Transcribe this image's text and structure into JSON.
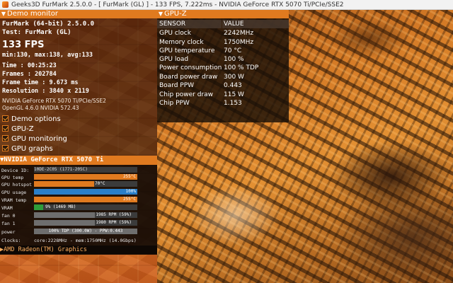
{
  "window": {
    "title": "Geeks3D FurMark 2.5.0.0 - [ FurMark (GL) ] - 133 FPS, 7.222ms - NVIDIA GeForce RTX 5070 Ti/PCIe/SSE2"
  },
  "demo_monitor": {
    "header": "Demo monitor",
    "app_line": "FurMark (64-bit) 2.5.0.0",
    "test_line": "Test: FurMark (GL)",
    "fps": "133 FPS",
    "minmax": "min:130, max:138, avg:133",
    "time": "Time        : 00:25:23",
    "frames": "Frames      : 202784",
    "frame_time": "Frame time : 9.673 ms",
    "resolution": "Resolution : 3840 x 2119",
    "renderer": "NVIDIA GeForce RTX 5070 Ti/PCIe/SSE2",
    "opengl": "OpenGL 4.6.0 NVIDIA 572.43",
    "options": [
      "Demo options",
      "GPU-Z",
      "GPU monitoring",
      "GPU graphs"
    ]
  },
  "nvidia": {
    "header": "NVIDIA GeForce RTX 5070 Ti",
    "device_id_label": "Device ID:",
    "device_id": "10DE-2C05 (1771-205C)",
    "gpu_temp": {
      "label": "GPU temp",
      "text": "255°C",
      "pct": 100,
      "color": "#e07a1f"
    },
    "gpu_hotspot": {
      "label": "GPU hotspot",
      "text": "70°C",
      "pct": 58,
      "color": "#e07a1f"
    },
    "gpu_usage": {
      "label": "GPU usage",
      "text": "100%",
      "pct": 100,
      "color": "#2a7fc9"
    },
    "vram_temp": {
      "label": "VRAM temp",
      "text": "255°C",
      "pct": 100,
      "color": "#e07a1f"
    },
    "vram": {
      "label": "VRAM",
      "text": "9% (1469 MB)",
      "pct": 9,
      "color": "#2e9c3a"
    },
    "fan0": {
      "label": "fan 0",
      "text": "1985 RPM (59%)",
      "pct": 59,
      "color": "#6e6e6e"
    },
    "fan1": {
      "label": "fan 1",
      "text": "1980 RPM (59%)",
      "pct": 59,
      "color": "#6e6e6e"
    },
    "power": {
      "label": "power",
      "text": "100% TDP (300.0W) - PPW:0.443",
      "pct": 100,
      "color": "#6e6e6e"
    },
    "clocks_label": "Clocks:",
    "clocks": "core:2228MHz - mem:1750MHz (14.0Gbps)"
  },
  "amd": {
    "header": "AMD Radeon(TM) Graphics"
  },
  "gpuz": {
    "header": "GPU-Z",
    "col_sensor": "SENSOR",
    "col_value": "VALUE",
    "rows": [
      {
        "k": "GPU clock",
        "v": "2242MHz"
      },
      {
        "k": "Memory clock",
        "v": "1750MHz"
      },
      {
        "k": "GPU temperature",
        "v": "70 °C"
      },
      {
        "k": "GPU load",
        "v": "100 %"
      },
      {
        "k": "Power consumption",
        "v": "100 % TDP"
      },
      {
        "k": "Board power draw",
        "v": "300 W"
      },
      {
        "k": "Board PPW",
        "v": "0.443"
      },
      {
        "k": "Chip power draw",
        "v": "115 W"
      },
      {
        "k": "Chip PPW",
        "v": "1.153"
      }
    ]
  }
}
